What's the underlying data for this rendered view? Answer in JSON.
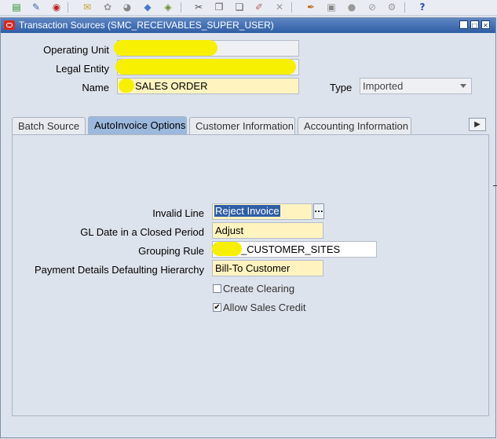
{
  "toolbar": {
    "icons": [
      "new-icon",
      "find-icon",
      "navigator-icon",
      "save-icon",
      "print-icon",
      "close-icon",
      "clear-icon",
      "attachments-icon",
      "cut-icon",
      "copy-icon",
      "paste-icon",
      "edit-icon",
      "delete-icon",
      "pen-icon",
      "folder-icon",
      "record-icon",
      "attach-icon",
      "tools-icon",
      "help-icon"
    ],
    "help_label": "?"
  },
  "window": {
    "title": "Transaction Sources (SMC_RECEIVABLES_SUPER_USER)"
  },
  "header": {
    "operating_unit_label": "Operating Unit",
    "legal_entity_label": "Legal Entity",
    "name_label": "Name",
    "name_value": "SALES ORDER",
    "type_label": "Type",
    "type_value": "Imported"
  },
  "tabs": [
    {
      "label": "Batch Source"
    },
    {
      "label": "AutoInvoice Options",
      "active": true
    },
    {
      "label": "Customer Information"
    },
    {
      "label": "Accounting Information"
    }
  ],
  "form": {
    "invalid_line_label": "Invalid Line",
    "invalid_line_value": "Reject Invoice",
    "lov_label": "...",
    "gl_date_label": "GL Date in a Closed Period",
    "gl_date_value": "Adjust",
    "grouping_rule_label": "Grouping Rule",
    "grouping_rule_value": "_CUSTOMER_SITES",
    "payment_label": "Payment Details Defaulting Hierarchy",
    "payment_value": "Bill-To Customer",
    "create_clearing_label": "Create Clearing",
    "create_clearing_checked": false,
    "allow_sales_credit_label": "Allow Sales Credit",
    "allow_sales_credit_checked": true
  },
  "colors": {
    "required_field": "#fff4c0",
    "titlebar": "#2f5ea6",
    "active_tab": "#9cb9dd",
    "redaction": "#f7f000"
  }
}
